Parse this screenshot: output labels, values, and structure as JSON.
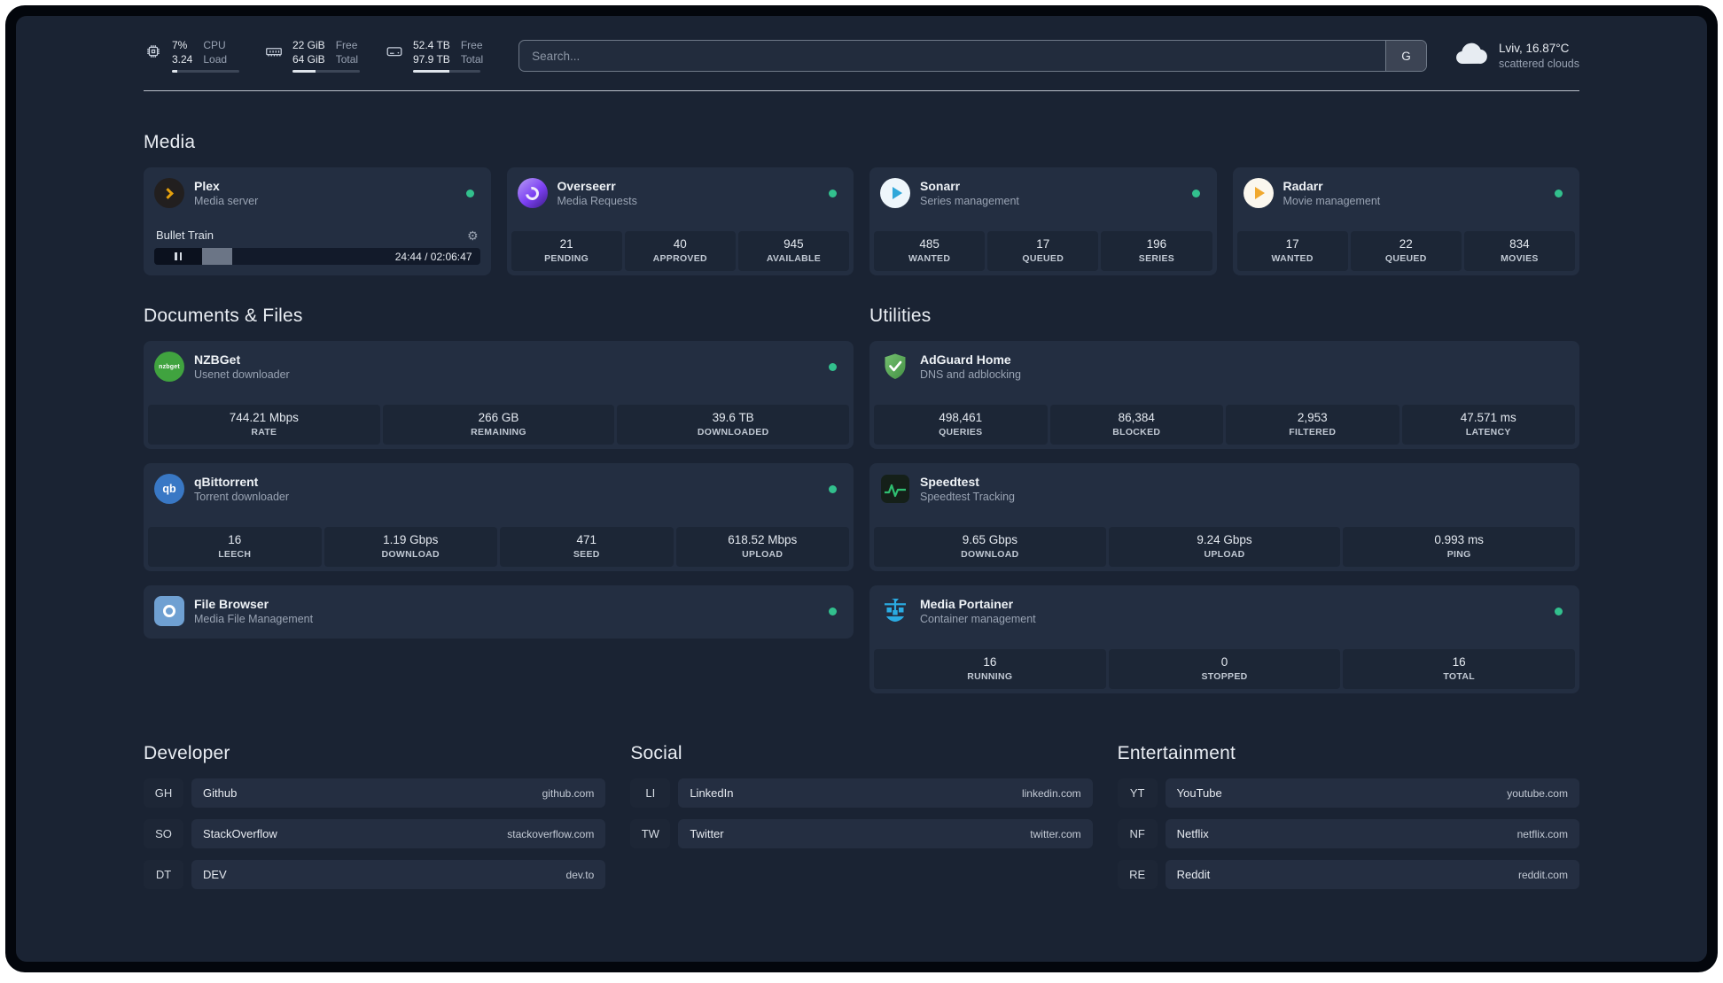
{
  "topbar": {
    "cpu": {
      "value_top": "7%",
      "value_bottom": "3.24",
      "label_top": "CPU",
      "label_bottom": "Load"
    },
    "memory": {
      "value_top": "22 GiB",
      "value_bottom": "64 GiB",
      "label_top": "Free",
      "label_bottom": "Total"
    },
    "disk": {
      "value_top": "52.4 TB",
      "value_bottom": "97.9 TB",
      "label_top": "Free",
      "label_bottom": "Total"
    },
    "search": {
      "placeholder": "Search...",
      "provider_label": "G"
    },
    "weather": {
      "location": "Lviv, 16.87°C",
      "condition": "scattered clouds"
    }
  },
  "media": {
    "title": "Media",
    "plex": {
      "name": "Plex",
      "subtitle": "Media server",
      "track": "Bullet Train",
      "time": "24:44 / 02:06:47"
    },
    "overseerr": {
      "name": "Overseerr",
      "subtitle": "Media Requests",
      "stats": [
        {
          "value": "21",
          "label": "PENDING"
        },
        {
          "value": "40",
          "label": "APPROVED"
        },
        {
          "value": "945",
          "label": "AVAILABLE"
        }
      ]
    },
    "sonarr": {
      "name": "Sonarr",
      "subtitle": "Series management",
      "stats": [
        {
          "value": "485",
          "label": "WANTED"
        },
        {
          "value": "17",
          "label": "QUEUED"
        },
        {
          "value": "196",
          "label": "SERIES"
        }
      ]
    },
    "radarr": {
      "name": "Radarr",
      "subtitle": "Movie management",
      "stats": [
        {
          "value": "17",
          "label": "WANTED"
        },
        {
          "value": "22",
          "label": "QUEUED"
        },
        {
          "value": "834",
          "label": "MOVIES"
        }
      ]
    }
  },
  "documents": {
    "title": "Documents & Files",
    "nzbget": {
      "name": "NZBGet",
      "subtitle": "Usenet downloader",
      "icon_text": "nzbget",
      "stats": [
        {
          "value": "744.21 Mbps",
          "label": "RATE"
        },
        {
          "value": "266 GB",
          "label": "REMAINING"
        },
        {
          "value": "39.6 TB",
          "label": "DOWNLOADED"
        }
      ]
    },
    "qbittorrent": {
      "name": "qBittorrent",
      "subtitle": "Torrent downloader",
      "icon_text": "qb",
      "stats": [
        {
          "value": "16",
          "label": "LEECH"
        },
        {
          "value": "1.19 Gbps",
          "label": "DOWNLOAD"
        },
        {
          "value": "471",
          "label": "SEED"
        },
        {
          "value": "618.52 Mbps",
          "label": "UPLOAD"
        }
      ]
    },
    "filebrowser": {
      "name": "File Browser",
      "subtitle": "Media File Management"
    }
  },
  "utilities": {
    "title": "Utilities",
    "adguard": {
      "name": "AdGuard Home",
      "subtitle": "DNS and adblocking",
      "stats": [
        {
          "value": "498,461",
          "label": "QUERIES"
        },
        {
          "value": "86,384",
          "label": "BLOCKED"
        },
        {
          "value": "2,953",
          "label": "FILTERED"
        },
        {
          "value": "47.571 ms",
          "label": "LATENCY"
        }
      ]
    },
    "speedtest": {
      "name": "Speedtest",
      "subtitle": "Speedtest Tracking",
      "stats": [
        {
          "value": "9.65 Gbps",
          "label": "DOWNLOAD"
        },
        {
          "value": "9.24 Gbps",
          "label": "UPLOAD"
        },
        {
          "value": "0.993 ms",
          "label": "PING"
        }
      ]
    },
    "portainer": {
      "name": "Media Portainer",
      "subtitle": "Container management",
      "stats": [
        {
          "value": "16",
          "label": "RUNNING"
        },
        {
          "value": "0",
          "label": "STOPPED"
        },
        {
          "value": "16",
          "label": "TOTAL"
        }
      ]
    }
  },
  "bookmarks": {
    "developer": {
      "title": "Developer",
      "items": [
        {
          "abbr": "GH",
          "name": "Github",
          "url": "github.com"
        },
        {
          "abbr": "SO",
          "name": "StackOverflow",
          "url": "stackoverflow.com"
        },
        {
          "abbr": "DT",
          "name": "DEV",
          "url": "dev.to"
        }
      ]
    },
    "social": {
      "title": "Social",
      "items": [
        {
          "abbr": "LI",
          "name": "LinkedIn",
          "url": "linkedin.com"
        },
        {
          "abbr": "TW",
          "name": "Twitter",
          "url": "twitter.com"
        }
      ]
    },
    "entertainment": {
      "title": "Entertainment",
      "items": [
        {
          "abbr": "YT",
          "name": "YouTube",
          "url": "youtube.com"
        },
        {
          "abbr": "NF",
          "name": "Netflix",
          "url": "netflix.com"
        },
        {
          "abbr": "RE",
          "name": "Reddit",
          "url": "reddit.com"
        }
      ]
    }
  }
}
